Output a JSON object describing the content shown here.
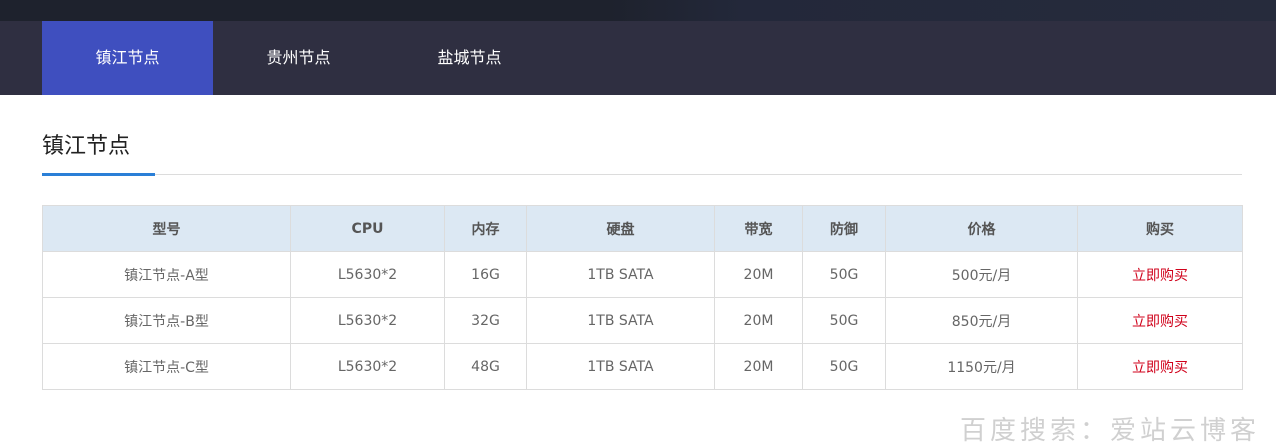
{
  "tabs": [
    {
      "label": "镇江节点",
      "active": true
    },
    {
      "label": "贵州节点",
      "active": false
    },
    {
      "label": "盐城节点",
      "active": false
    }
  ],
  "section": {
    "title": "镇江节点"
  },
  "table": {
    "headers": [
      "型号",
      "CPU",
      "内存",
      "硬盘",
      "带宽",
      "防御",
      "价格",
      "购买"
    ],
    "rows": [
      {
        "model": "镇江节点-A型",
        "cpu": "L5630*2",
        "memory": "16G",
        "disk": "1TB SATA",
        "bandwidth": "20M",
        "defense": "50G",
        "price": "500元/月",
        "buy": "立即购买"
      },
      {
        "model": "镇江节点-B型",
        "cpu": "L5630*2",
        "memory": "32G",
        "disk": "1TB SATA",
        "bandwidth": "20M",
        "defense": "50G",
        "price": "850元/月",
        "buy": "立即购买"
      },
      {
        "model": "镇江节点-C型",
        "cpu": "L5630*2",
        "memory": "48G",
        "disk": "1TB SATA",
        "bandwidth": "20M",
        "defense": "50G",
        "price": "1150元/月",
        "buy": "立即购买"
      }
    ]
  },
  "watermark": "百度搜索：爱站云博客",
  "colors": {
    "tab_active": "#3f4fbf",
    "tab_bar": "#2f2f41",
    "title_accent": "#2a7fd7",
    "header_bg": "#dce8f3",
    "buy_link": "#d0021b"
  }
}
